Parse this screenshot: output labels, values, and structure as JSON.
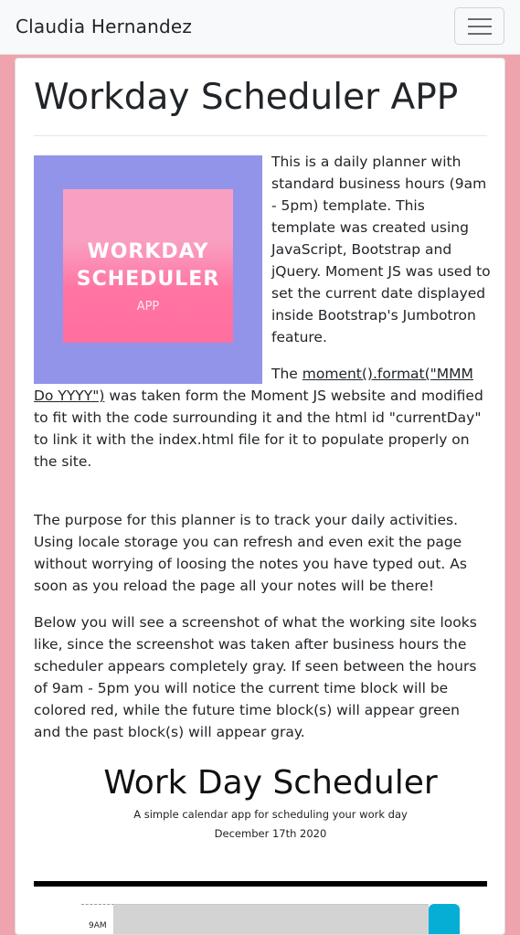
{
  "navbar": {
    "brand": "Claudia Hernandez",
    "menu_icon": "hamburger-menu-icon"
  },
  "main": {
    "title": "Workday Scheduler APP",
    "logo": {
      "line1": "WORKDAY",
      "line2": "SCHEDULER",
      "line3": "APP"
    },
    "para1": "This is a daily planner with standard business hours (9am - 5pm) template. This template was created using JavaScript, Bootstrap and jQuery. Moment JS was used to set the current date displayed inside Bootstrap's Jumbotron feature.",
    "para2_prefix": "The ",
    "para2_link": "moment().format(\"MMM Do YYYY\")",
    "para2_suffix": " was taken form the Moment JS website and modified to fit with the code surrounding it and the html id \"currentDay\" to link it with the index.html file for it to populate properly on the site.",
    "para3": "The purpose for this planner is to track your daily activities. Using locale storage you can refresh and even exit the page without worrying of loosing the notes you have typed out. As soon as you reload the page all your notes will be there!",
    "para4": "Below you will see a screenshot of what the working site looks like, since the screenshot was taken after business hours the scheduler appears completely gray. If seen between the hours of 9am - 5pm you will notice the current time block will be colored red, while the future time block(s) will appear green and the past block(s) will appear gray.",
    "screenshot": {
      "title": "Work Day Scheduler",
      "subtitle": "A simple calendar app for scheduling your work day",
      "date": "December 17th 2020",
      "first_hour": "9AM"
    }
  },
  "colors": {
    "page_background": "#efa3ad",
    "logo_background": "#9294e9",
    "logo_pink": "#ff74a2",
    "save_button": "#06aed5",
    "past_block": "#d3d3d3"
  }
}
